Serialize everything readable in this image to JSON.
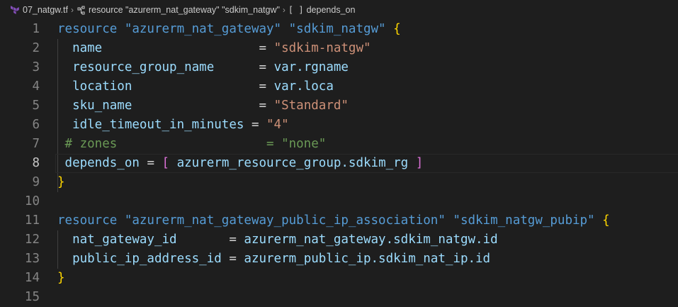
{
  "breadcrumb": {
    "file": "07_natgw.tf",
    "resource": "resource \"azurerm_nat_gateway\" \"sdkim_natgw\"",
    "symbol": "depends_on"
  },
  "editor": {
    "active_line": 8,
    "lines": [
      {
        "n": "1",
        "tokens": [
          {
            "t": "resource ",
            "c": "k"
          },
          {
            "t": "\"azurerm_nat_gateway\" \"sdkim_natgw\" ",
            "c": "k"
          },
          {
            "t": "{",
            "c": "b1"
          }
        ]
      },
      {
        "n": "2",
        "tokens": [
          {
            "t": "  name                     ",
            "c": "v"
          },
          {
            "t": "= ",
            "c": "p"
          },
          {
            "t": "\"sdkim-natgw\"",
            "c": "s"
          }
        ]
      },
      {
        "n": "3",
        "tokens": [
          {
            "t": "  resource_group_name      ",
            "c": "v"
          },
          {
            "t": "= ",
            "c": "p"
          },
          {
            "t": "var.rgname",
            "c": "v"
          }
        ]
      },
      {
        "n": "4",
        "tokens": [
          {
            "t": "  location                 ",
            "c": "v"
          },
          {
            "t": "= ",
            "c": "p"
          },
          {
            "t": "var.loca",
            "c": "v"
          }
        ]
      },
      {
        "n": "5",
        "tokens": [
          {
            "t": "  sku_name                 ",
            "c": "v"
          },
          {
            "t": "= ",
            "c": "p"
          },
          {
            "t": "\"Standard\"",
            "c": "s"
          }
        ]
      },
      {
        "n": "6",
        "tokens": [
          {
            "t": "  idle_timeout_in_minutes ",
            "c": "v"
          },
          {
            "t": "= ",
            "c": "p"
          },
          {
            "t": "\"4\"",
            "c": "s"
          }
        ]
      },
      {
        "n": "7",
        "tokens": [
          {
            "t": " # zones                    = \"none\"",
            "c": "c"
          }
        ]
      },
      {
        "n": "8",
        "tokens": [
          {
            "t": " depends_on ",
            "c": "v"
          },
          {
            "t": "= ",
            "c": "p"
          },
          {
            "t": "[",
            "c": "b2"
          },
          {
            "t": " azurerm_resource_group.sdkim_rg ",
            "c": "v"
          },
          {
            "t": "]",
            "c": "b2"
          }
        ]
      },
      {
        "n": "9",
        "tokens": [
          {
            "t": "}",
            "c": "b1"
          }
        ]
      },
      {
        "n": "10",
        "tokens": []
      },
      {
        "n": "11",
        "tokens": [
          {
            "t": "resource ",
            "c": "k"
          },
          {
            "t": "\"azurerm_nat_gateway_public_ip_association\" \"sdkim_natgw_pubip\" ",
            "c": "k"
          },
          {
            "t": "{",
            "c": "b1"
          }
        ]
      },
      {
        "n": "12",
        "tokens": [
          {
            "t": "  nat_gateway_id       ",
            "c": "v"
          },
          {
            "t": "= ",
            "c": "p"
          },
          {
            "t": "azurerm_nat_gateway.sdkim_natgw.id",
            "c": "v"
          }
        ]
      },
      {
        "n": "13",
        "tokens": [
          {
            "t": "  public_ip_address_id ",
            "c": "v"
          },
          {
            "t": "= ",
            "c": "p"
          },
          {
            "t": "azurerm_public_ip.sdkim_nat_ip.id",
            "c": "v"
          }
        ]
      },
      {
        "n": "14",
        "tokens": [
          {
            "t": "}",
            "c": "b1"
          }
        ]
      },
      {
        "n": "15",
        "tokens": []
      }
    ]
  },
  "colors": {
    "background": "#1e1e1e",
    "keyword": "#569cd6",
    "string": "#ce9178",
    "variable": "#9cdcfe",
    "comment": "#6a9955",
    "brace": "#ffd700",
    "bracket": "#da70d6"
  },
  "icons": {
    "file": "terraform-icon",
    "symbol": "symbol-structure-icon",
    "array": "symbol-array-icon"
  }
}
